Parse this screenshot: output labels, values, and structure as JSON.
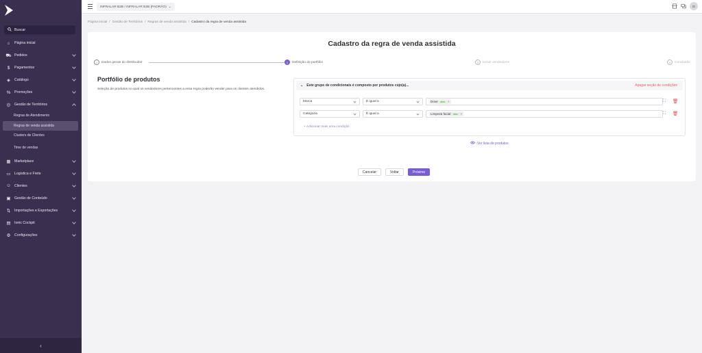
{
  "topbar": {
    "account_label": "INFRALAR B2B / INFRALAR B2B (PADRÃO)",
    "avatar_initials": "IG"
  },
  "sidebar": {
    "search_label": "Buscar",
    "items": [
      {
        "label": "Página inicial",
        "icon": "home-icon"
      },
      {
        "label": "Pedidos",
        "icon": "cart-icon"
      },
      {
        "label": "Pagamentos",
        "icon": "dollar-icon"
      },
      {
        "label": "Catálogo",
        "icon": "tag-icon"
      },
      {
        "label": "Promoções",
        "icon": "percent-icon"
      },
      {
        "label": "Gestão de Territórios",
        "icon": "map-icon"
      }
    ],
    "sub_items": [
      "Regras de Atendimento",
      "Regras de venda assistida",
      "Clusters de Clientes",
      "Time de vendas"
    ],
    "items_after": [
      {
        "label": "Marketplace",
        "icon": "store-icon"
      },
      {
        "label": "Logística e Frete",
        "icon": "truck-icon"
      },
      {
        "label": "Clientes",
        "icon": "users-icon"
      },
      {
        "label": "Gestão de Conteúdo",
        "icon": "content-icon"
      },
      {
        "label": "Importações e Exportações",
        "icon": "transfer-icon"
      },
      {
        "label": "Ionic Cockpit",
        "icon": "cockpit-icon"
      },
      {
        "label": "Configurações",
        "icon": "gear-icon"
      }
    ]
  },
  "breadcrumb": [
    "Página inicial",
    "Gestão de Territórios",
    "Regras de venda assistida",
    "Cadastro da regra de venda assistida"
  ],
  "page": {
    "title": "Cadastro da regra de venda assistida",
    "steps": [
      {
        "num": "✓",
        "label": "Dados gerais do distribuidor"
      },
      {
        "num": "2",
        "label": "Definição do portfólio"
      },
      {
        "num": "3",
        "label": "Incluir vendedores"
      },
      {
        "num": "4",
        "label": "Conclusão"
      }
    ],
    "section_title": "Portfólio de produtos",
    "section_desc": "Seleção de produtos no qual os vendedores pertencentes a essa regra poderão vender para os clientes atendidos.",
    "group_header": "Este grupo de condicionais é composto por produtos cujo(a)...",
    "remove_group": "Apagar seção de condições",
    "conditions": [
      {
        "field": "Marca",
        "operator": "É igual a",
        "value": "Dove",
        "badge": "ativo"
      },
      {
        "field": "Categoria",
        "operator": "É igual a",
        "value": "Limpeza facial",
        "badge": "ativo"
      }
    ],
    "add_condition": "+ Adicionar mais uma condição",
    "view_products": "Ver lista de produtos",
    "buttons": {
      "cancel": "Cancelar",
      "back": "Voltar",
      "next": "Próximo"
    }
  }
}
